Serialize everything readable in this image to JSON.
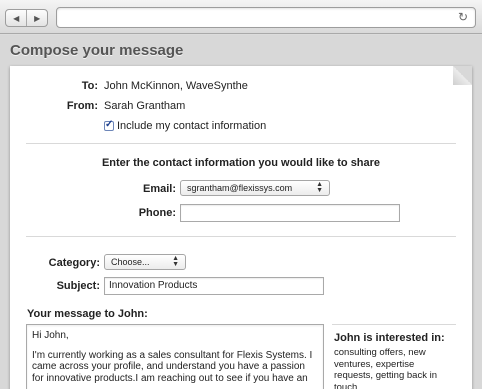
{
  "browser": {
    "back_icon": "back-arrow-icon",
    "forward_icon": "forward-arrow-icon",
    "url": "",
    "reload_icon": "reload-icon"
  },
  "page_title": "Compose your message",
  "header": {
    "to_label": "To:",
    "to_value": "John McKinnon, WaveSynthe",
    "from_label": "From:",
    "from_value": "Sarah Grantham",
    "include_contact_label": "Include my contact information",
    "include_contact_checked": true
  },
  "contact": {
    "heading": "Enter the contact information you would like to share",
    "email_label": "Email:",
    "email_value": "sgrantham@flexissys.com",
    "phone_label": "Phone:",
    "phone_value": ""
  },
  "details": {
    "category_label": "Category:",
    "category_value": "Choose...",
    "subject_label": "Subject:",
    "subject_value": "Innovation Products"
  },
  "message": {
    "heading": "Your message to John:",
    "greeting": "Hi John,",
    "body": "I'm currently working as a sales consultant for Flexis Systems. I came across your profile, and understand you have a passion for innovative products.I am reaching out to see if you have an"
  },
  "interests": {
    "heading": "John is interested in:",
    "text": "consulting offers, new ventures, expertise requests, getting back in touch"
  }
}
